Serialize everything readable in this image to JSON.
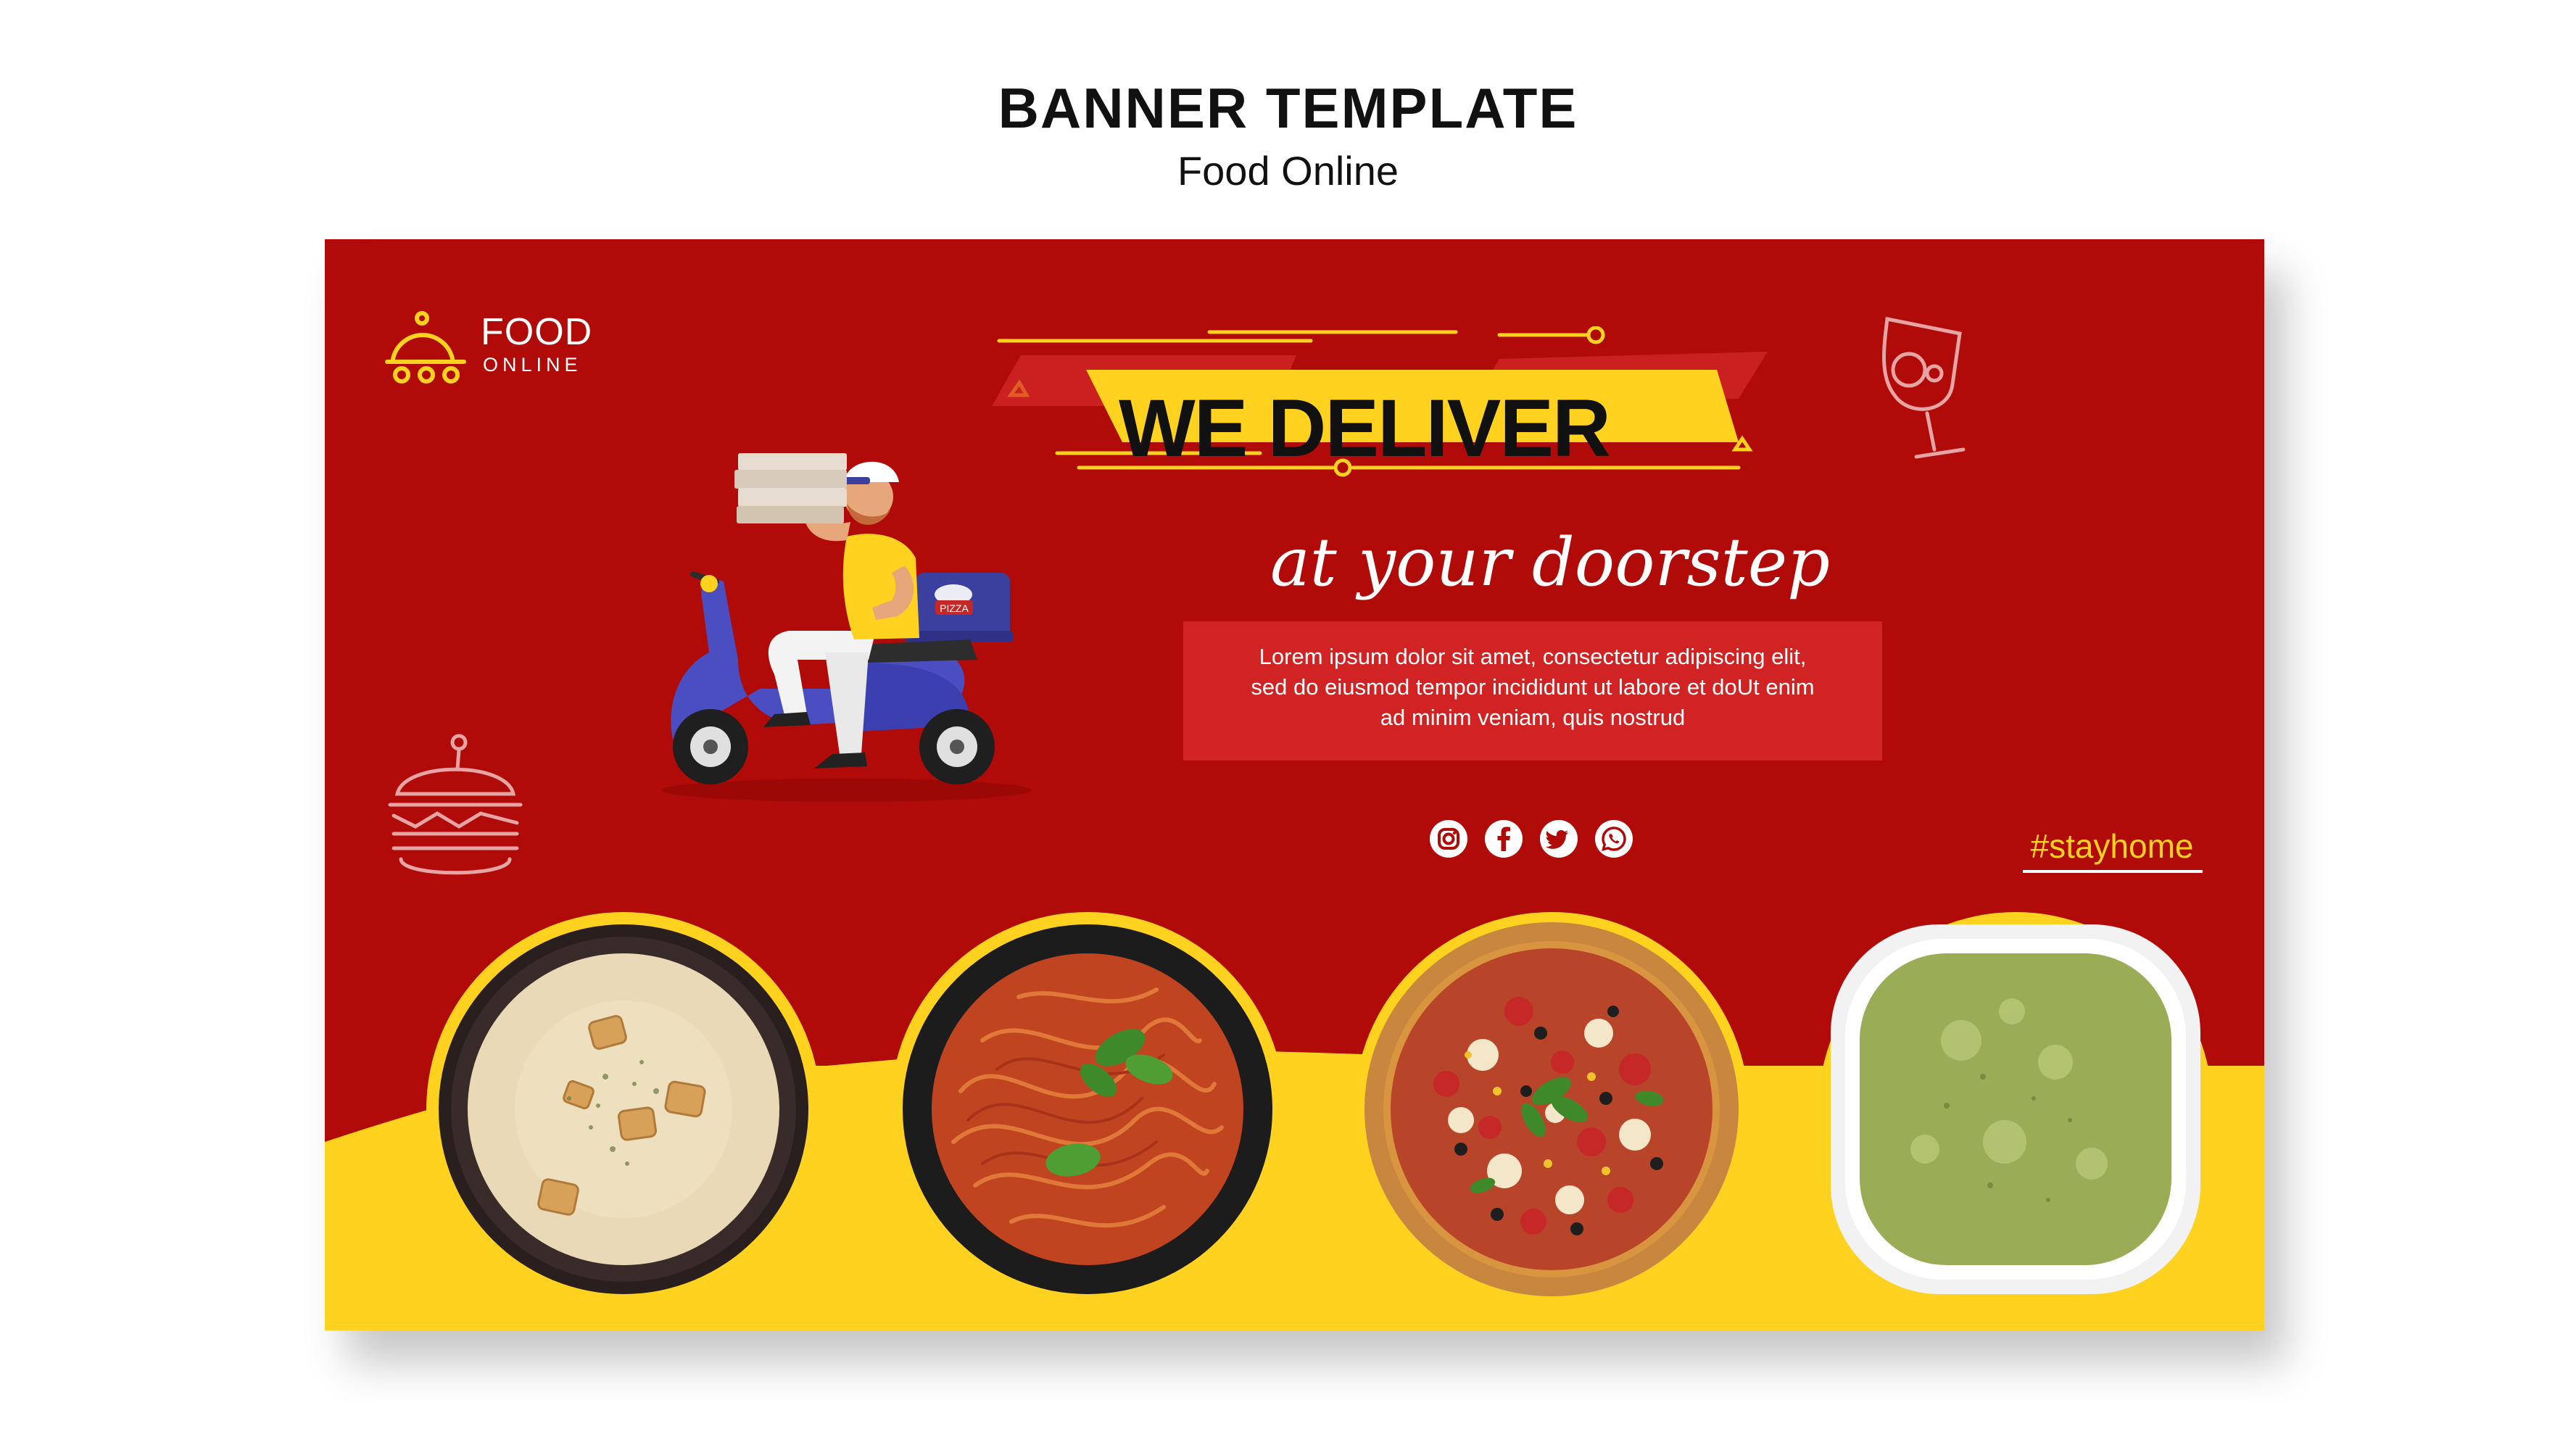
{
  "page": {
    "title": "BANNER TEMPLATE",
    "subtitle": "Food Online"
  },
  "banner": {
    "logo": {
      "line1": "FOOD",
      "line2": "ONLINE",
      "icon": "cloche-on-cart-icon"
    },
    "headline": "WE DELIVER",
    "tagline": "at your doorstep",
    "description": [
      "Lorem ipsum dolor sit amet, consectetur adipiscing elit,",
      "sed do eiusmod tempor incididunt ut labore et doUt enim",
      "ad minim veniam, quis nostrud"
    ],
    "social_icons": [
      "instagram-icon",
      "facebook-icon",
      "twitter-icon",
      "whatsapp-icon"
    ],
    "hashtag": "#stayhome",
    "illustration": "delivery-man-on-scooter-with-pizza-boxes",
    "decorations": [
      "wine-glass-outline-icon",
      "burger-outline-icon"
    ],
    "dishes": [
      "cream-soup-with-croutons",
      "spaghetti-with-tomato-sauce",
      "pizza",
      "green-pea-soup"
    ]
  },
  "colors": {
    "banner_red": "#b00b08",
    "accent_yellow": "#ffd21f",
    "headline_text": "#111111",
    "text_white": "#ffffff"
  }
}
